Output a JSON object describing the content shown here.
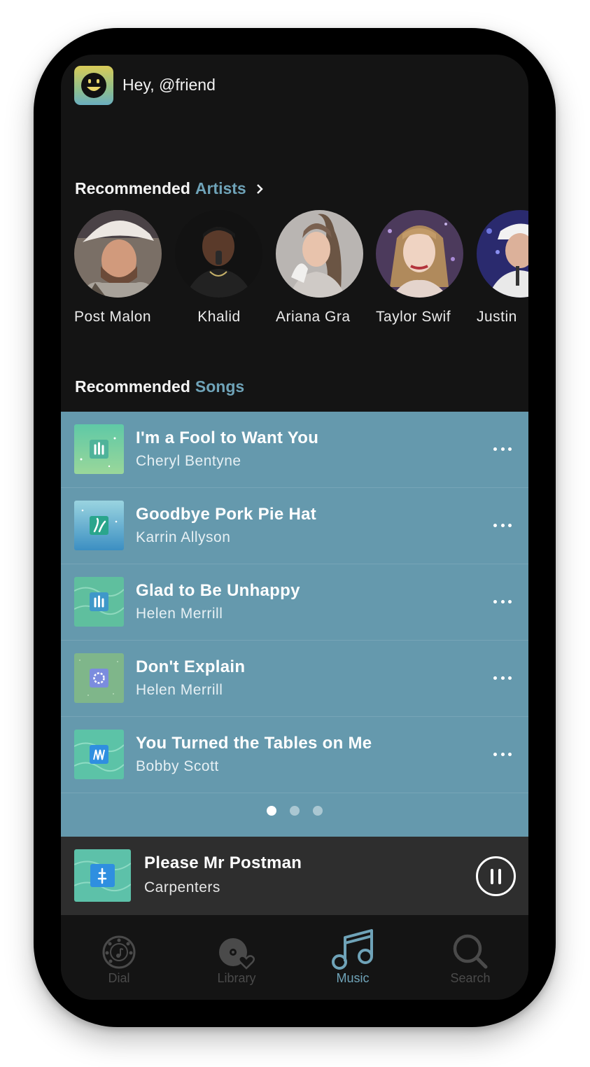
{
  "header": {
    "greeting": "Hey, @friend"
  },
  "recommended_artists": {
    "title_prefix": "Recommended",
    "title_accent": "Artists",
    "artists": [
      {
        "name": "Post Malone",
        "shown": "Post Malon"
      },
      {
        "name": "Khalid",
        "shown": "Khalid"
      },
      {
        "name": "Ariana Grande",
        "shown": "Ariana Gra"
      },
      {
        "name": "Taylor Swift",
        "shown": "Taylor Swif"
      },
      {
        "name": "Justin",
        "shown": "Justin"
      }
    ]
  },
  "recommended_songs": {
    "title_prefix": "Recommended",
    "title_accent": "Songs",
    "songs": [
      {
        "title": "I'm a Fool to Want You",
        "artist": "Cheryl Bentyne"
      },
      {
        "title": "Goodbye Pork Pie Hat",
        "artist": "Karrin Allyson"
      },
      {
        "title": "Glad to Be Unhappy",
        "artist": "Helen Merrill"
      },
      {
        "title": "Don't Explain",
        "artist": "Helen Merrill"
      },
      {
        "title": "You Turned the Tables on Me",
        "artist": "Bobby Scott"
      }
    ],
    "pagination": {
      "pages": 3,
      "current": 1
    }
  },
  "now_playing": {
    "title": "Please Mr Postman",
    "artist": "Carpenters",
    "state": "playing"
  },
  "tabbar": {
    "tabs": [
      {
        "label": "Dial",
        "icon": "rotary-dial-icon"
      },
      {
        "label": "Library",
        "icon": "disc-heart-icon"
      },
      {
        "label": "Music",
        "icon": "music-note-icon",
        "active": true
      },
      {
        "label": "Search",
        "icon": "search-icon"
      }
    ]
  },
  "colors": {
    "accent": "#6fa3b8",
    "songs_panel": "#6599ad",
    "background": "#141414",
    "now_playing": "#2e2e2e"
  }
}
